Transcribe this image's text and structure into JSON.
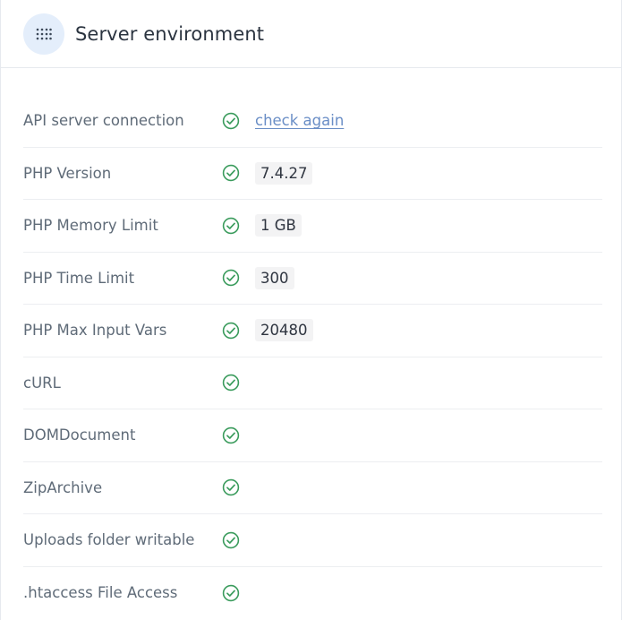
{
  "header": {
    "title": "Server environment",
    "icon": "grid-dots-icon"
  },
  "colors": {
    "check": "#3a9b5c",
    "link": "#6a8ec6",
    "header_icon_bg": "#e4eefb"
  },
  "rows": [
    {
      "label": "API server connection",
      "status": "ok",
      "value": "",
      "link": "check again"
    },
    {
      "label": "PHP Version",
      "status": "ok",
      "value": "7.4.27",
      "link": ""
    },
    {
      "label": "PHP Memory Limit",
      "status": "ok",
      "value": "1 GB",
      "link": ""
    },
    {
      "label": "PHP Time Limit",
      "status": "ok",
      "value": "300",
      "link": ""
    },
    {
      "label": "PHP Max Input Vars",
      "status": "ok",
      "value": "20480",
      "link": ""
    },
    {
      "label": "cURL",
      "status": "ok",
      "value": "",
      "link": ""
    },
    {
      "label": "DOMDocument",
      "status": "ok",
      "value": "",
      "link": ""
    },
    {
      "label": "ZipArchive",
      "status": "ok",
      "value": "",
      "link": ""
    },
    {
      "label": "Uploads folder writable",
      "status": "ok",
      "value": "",
      "link": ""
    },
    {
      "label": ".htaccess File Access",
      "status": "ok",
      "value": "",
      "link": ""
    }
  ]
}
